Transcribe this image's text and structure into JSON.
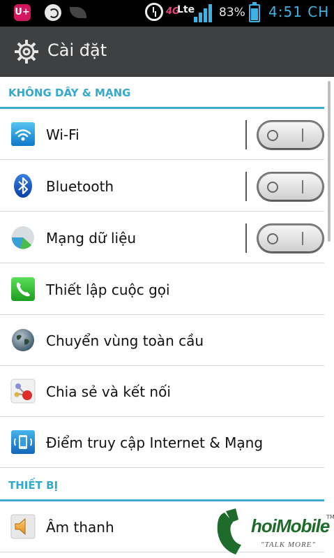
{
  "statusbar": {
    "carrier_icon": "U+",
    "network_prefix": "4G",
    "network": "Lte",
    "signal_level": 0.85,
    "battery_percent": "83%",
    "battery_level": 0.83,
    "time": "4:51 CH",
    "accent": "#3db3e3"
  },
  "actionbar": {
    "icon": "gear-icon",
    "title": "Cài đặt"
  },
  "sections": [
    {
      "title": "KHÔNG DÂY & MẠNG",
      "items": [
        {
          "label": "Wi-Fi",
          "icon": "wifi-icon",
          "toggle": "off"
        },
        {
          "label": "Bluetooth",
          "icon": "bluetooth-icon",
          "toggle": "off"
        },
        {
          "label": "Mạng dữ liệu",
          "icon": "mobile-data-icon",
          "toggle": "off"
        },
        {
          "label": "Thiết lập cuộc gọi",
          "icon": "phone-icon"
        },
        {
          "label": "Chuyển vùng toàn cầu",
          "icon": "globe-icon"
        },
        {
          "label": "Chia sẻ và kết nối",
          "icon": "share-connect-icon"
        },
        {
          "label": "Điểm truy cập Internet & Mạng",
          "icon": "hotspot-icon"
        }
      ]
    },
    {
      "title": "THIẾT BỊ",
      "items": [
        {
          "label": "Âm thanh",
          "icon": "speaker-icon"
        }
      ]
    }
  ],
  "watermark": {
    "brand": "hoiMobile",
    "tagline": "\"TALK MORE\"",
    "tm": "TM"
  },
  "colors": {
    "section_header": "#34a9cb",
    "actionbar_bg": "#3f4041"
  }
}
